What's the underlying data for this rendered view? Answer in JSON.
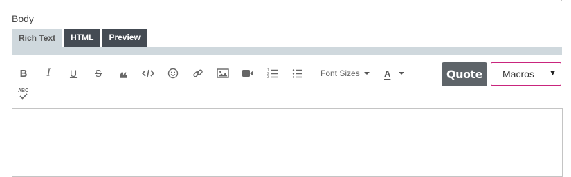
{
  "form": {
    "body_label": "Body"
  },
  "tabs": [
    {
      "label": "Rich Text",
      "active": true
    },
    {
      "label": "HTML",
      "active": false
    },
    {
      "label": "Preview",
      "active": false
    }
  ],
  "toolbar": {
    "bold": "B",
    "italic": "I",
    "underline": "U",
    "strike": "S",
    "blockquote": "❝",
    "font_sizes_label": "Font Sizes",
    "font_color_label": "A",
    "spellcheck_label": "ABC",
    "icons": [
      "bold-icon",
      "italic-icon",
      "underline-icon",
      "strikethrough-icon",
      "blockquote-icon",
      "code-icon",
      "emoji-icon",
      "link-icon",
      "image-icon",
      "video-icon",
      "ordered-list-icon",
      "unordered-list-icon",
      "spellcheck-icon"
    ]
  },
  "quote_button": {
    "label": "Quote"
  },
  "macros": {
    "value": "Macros",
    "arrow": "▼"
  },
  "editor": {
    "content": ""
  },
  "colors": {
    "tab_active_bg": "#cfd8dd",
    "tab_dark_bg": "#444b53",
    "quote_bg": "#5e6469",
    "macros_border": "#c9257d"
  }
}
